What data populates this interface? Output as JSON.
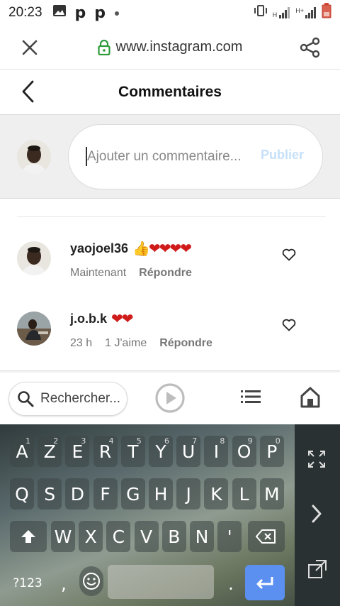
{
  "status_bar": {
    "time": "20:23",
    "left_icons": [
      "image-icon",
      "p-icon",
      "p-icon",
      "dot-icon"
    ],
    "right_icons": [
      "vibrate-icon",
      "signal-h-icon",
      "signal-hplus-icon",
      "battery-icon"
    ],
    "network_labels": [
      "H",
      "H+"
    ]
  },
  "browser": {
    "url": "www.instagram.com"
  },
  "header": {
    "title": "Commentaires"
  },
  "composer": {
    "placeholder": "Ajouter un commentaire...",
    "publish_label": "Publier"
  },
  "comments": [
    {
      "username": "yaojoel36",
      "text": "👍❤❤❤❤",
      "time": "Maintenant",
      "likes": "",
      "reply_label": "Répondre"
    },
    {
      "username": "j.o.b.k",
      "text": "❤❤",
      "time": "23 h",
      "likes": "1 J'aime",
      "reply_label": "Répondre"
    }
  ],
  "bottom_bar": {
    "search_placeholder": "Rechercher..."
  },
  "keyboard": {
    "row1": [
      {
        "k": "A",
        "h": "1"
      },
      {
        "k": "Z",
        "h": "2"
      },
      {
        "k": "E",
        "h": "3"
      },
      {
        "k": "R",
        "h": "4"
      },
      {
        "k": "T",
        "h": "5"
      },
      {
        "k": "Y",
        "h": "6"
      },
      {
        "k": "U",
        "h": "7"
      },
      {
        "k": "I",
        "h": "8"
      },
      {
        "k": "O",
        "h": "9"
      },
      {
        "k": "P",
        "h": "0"
      }
    ],
    "row2": [
      "Q",
      "S",
      "D",
      "F",
      "G",
      "H",
      "J",
      "K",
      "L",
      "M"
    ],
    "row3": [
      "W",
      "X",
      "C",
      "V",
      "B",
      "N",
      "'"
    ],
    "symbols_label": "?123",
    "comma": ",",
    "period": ".",
    "accent_color": "#5b8ff0"
  }
}
